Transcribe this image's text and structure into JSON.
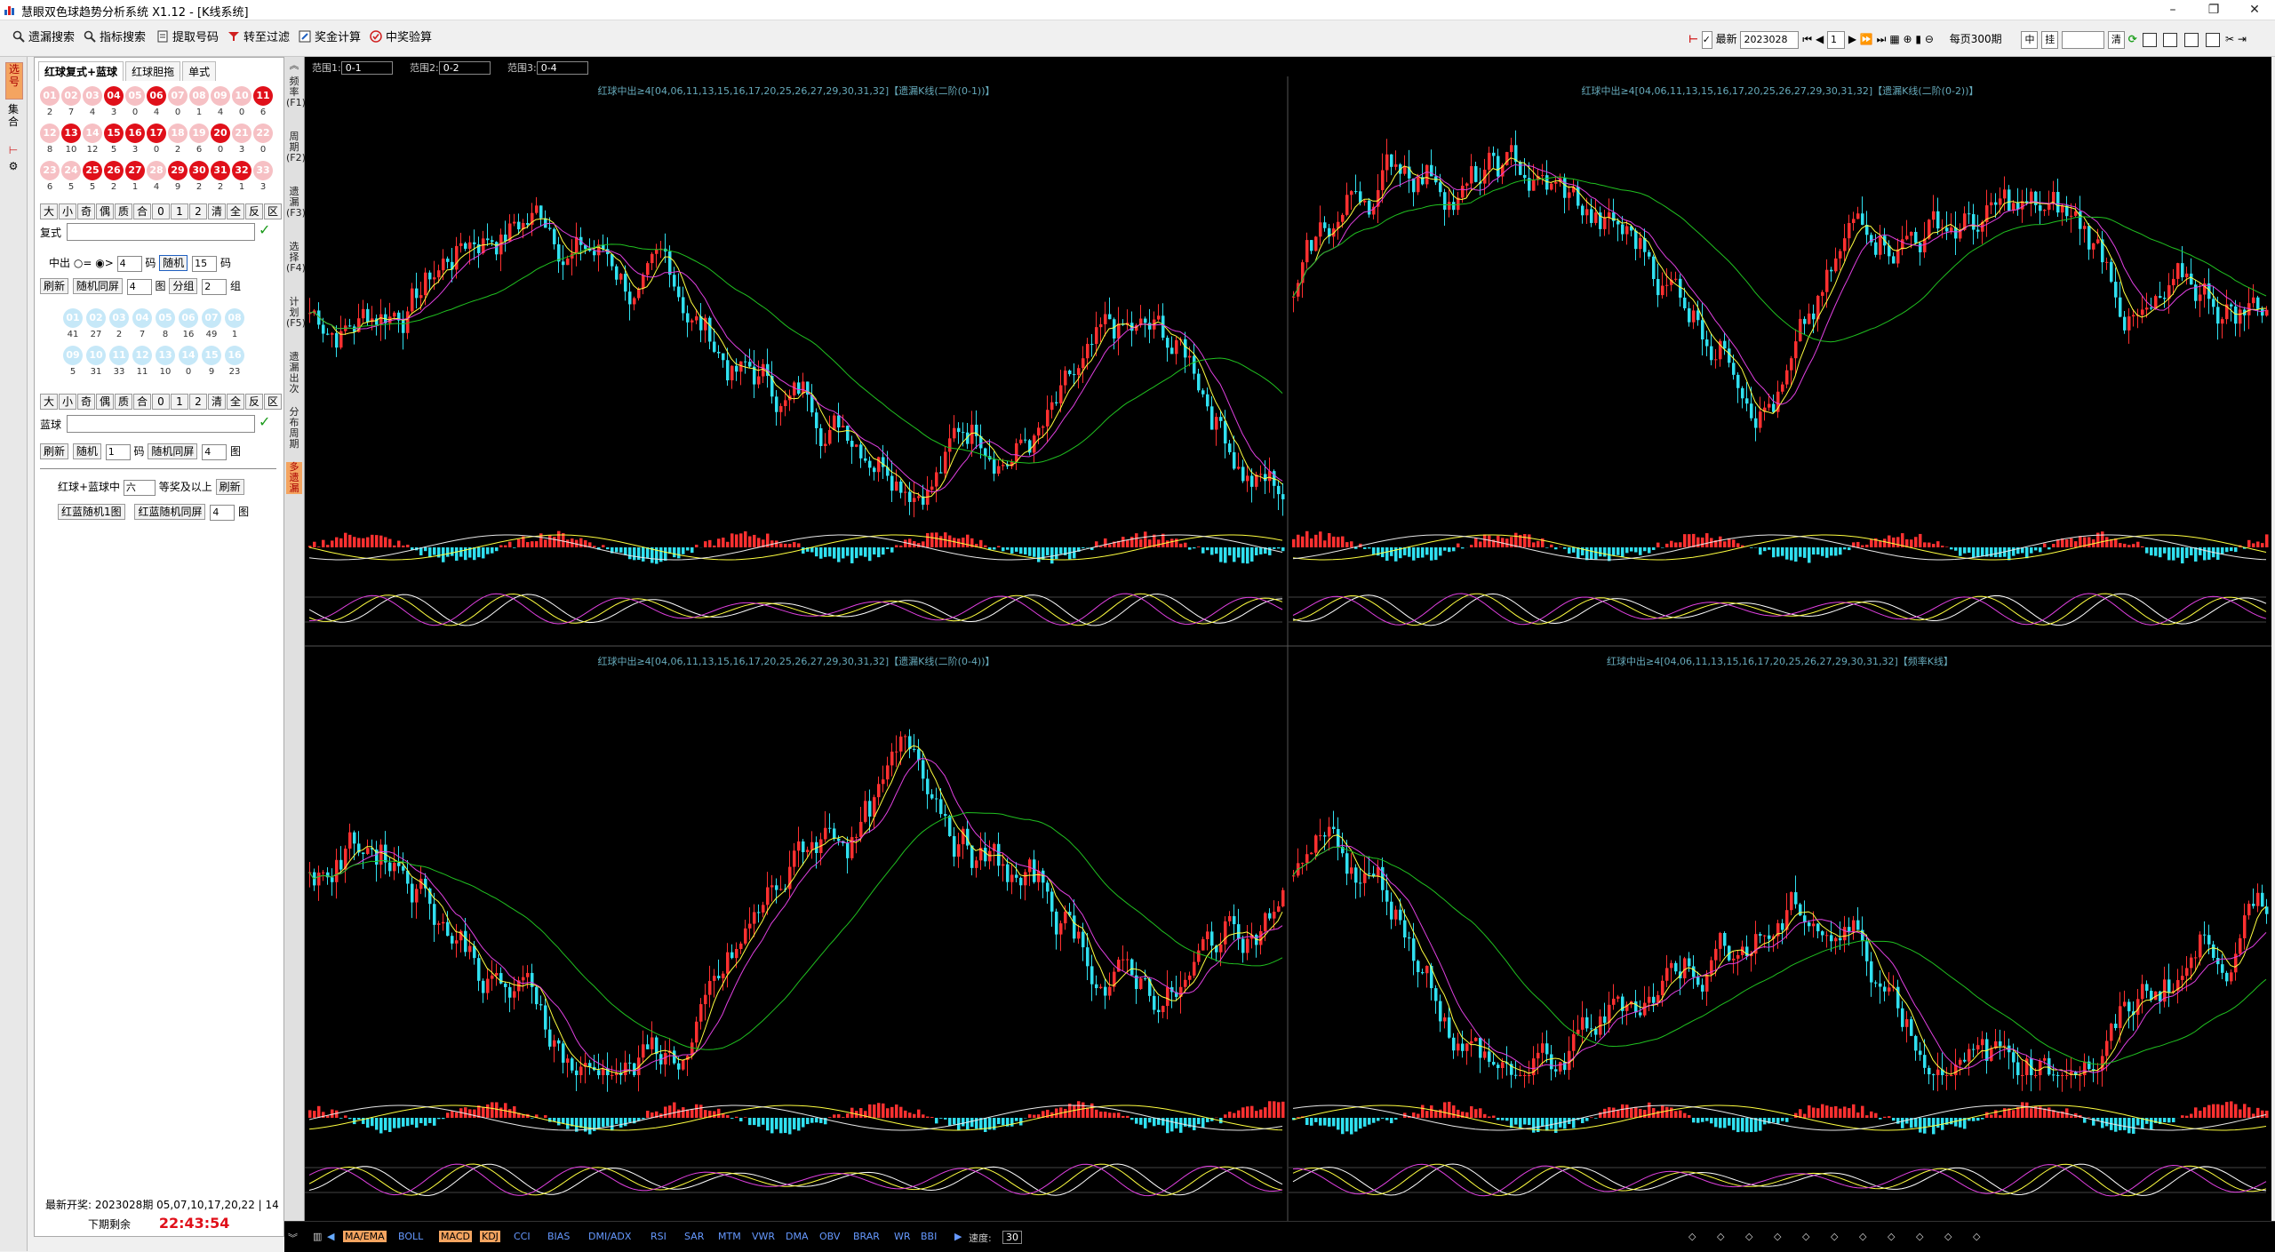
{
  "window": {
    "title": "慧眼双色球趋势分析系统 X1.12 - [K线系统]",
    "controls": [
      "–",
      "❐",
      "✕"
    ]
  },
  "toolbar": {
    "items": [
      {
        "label": "遗漏搜索",
        "icon": "search-icon"
      },
      {
        "label": "指标搜索",
        "icon": "search-icon"
      },
      {
        "label": "提取号码",
        "icon": "document-icon"
      },
      {
        "label": "转至过滤",
        "icon": "filter-icon"
      },
      {
        "label": "奖金计算",
        "icon": "edit-icon"
      },
      {
        "label": "中奖验算",
        "icon": "check-circle-icon"
      }
    ],
    "latest_label": "最新",
    "period_value": "2023028",
    "page_value": "1",
    "per_page_label": "每页300期",
    "mid_label": "中",
    "hang_label": "挂",
    "clear_label": "清"
  },
  "left_tabs": [
    {
      "label": "选号",
      "active": true
    },
    {
      "label": "集合",
      "active": false
    }
  ],
  "panel": {
    "tabs": [
      "红球复式+蓝球",
      "红球胆拖",
      "单式"
    ],
    "red_balls": [
      {
        "n": "01",
        "hit": false,
        "cnt": "2"
      },
      {
        "n": "02",
        "hit": false,
        "cnt": "7"
      },
      {
        "n": "03",
        "hit": false,
        "cnt": "4"
      },
      {
        "n": "04",
        "hit": true,
        "cnt": "3"
      },
      {
        "n": "05",
        "hit": false,
        "cnt": "0"
      },
      {
        "n": "06",
        "hit": true,
        "cnt": "4"
      },
      {
        "n": "07",
        "hit": false,
        "cnt": "0"
      },
      {
        "n": "08",
        "hit": false,
        "cnt": "1"
      },
      {
        "n": "09",
        "hit": false,
        "cnt": "4"
      },
      {
        "n": "10",
        "hit": false,
        "cnt": "0"
      },
      {
        "n": "11",
        "hit": true,
        "cnt": "6"
      },
      {
        "n": "12",
        "hit": false,
        "cnt": "8"
      },
      {
        "n": "13",
        "hit": true,
        "cnt": "10"
      },
      {
        "n": "14",
        "hit": false,
        "cnt": "12"
      },
      {
        "n": "15",
        "hit": true,
        "cnt": "5"
      },
      {
        "n": "16",
        "hit": true,
        "cnt": "3"
      },
      {
        "n": "17",
        "hit": true,
        "cnt": "0"
      },
      {
        "n": "18",
        "hit": false,
        "cnt": "2"
      },
      {
        "n": "19",
        "hit": false,
        "cnt": "6"
      },
      {
        "n": "20",
        "hit": true,
        "cnt": "0"
      },
      {
        "n": "21",
        "hit": false,
        "cnt": "3"
      },
      {
        "n": "22",
        "hit": false,
        "cnt": "0"
      },
      {
        "n": "23",
        "hit": false,
        "cnt": "6"
      },
      {
        "n": "24",
        "hit": false,
        "cnt": "5"
      },
      {
        "n": "25",
        "hit": true,
        "cnt": "5"
      },
      {
        "n": "26",
        "hit": true,
        "cnt": "2"
      },
      {
        "n": "27",
        "hit": true,
        "cnt": "1"
      },
      {
        "n": "28",
        "hit": false,
        "cnt": "4"
      },
      {
        "n": "29",
        "hit": true,
        "cnt": "9"
      },
      {
        "n": "30",
        "hit": true,
        "cnt": "2"
      },
      {
        "n": "31",
        "hit": true,
        "cnt": "2"
      },
      {
        "n": "32",
        "hit": true,
        "cnt": "1"
      },
      {
        "n": "33",
        "hit": false,
        "cnt": "3"
      }
    ],
    "filter_buttons": [
      "大",
      "小",
      "奇",
      "偶",
      "质",
      "合",
      "0",
      "1",
      "2",
      "清",
      "全",
      "反",
      "区"
    ],
    "fushi_label": "复式",
    "zhongchu_label": "中出",
    "eq_symbol": "=",
    "gt_symbol": ">",
    "zc_count": "4",
    "ma_label": "码",
    "random_btn": "随机",
    "random_count": "15",
    "refresh_btn": "刷新",
    "same_screen_btn": "随机同屏",
    "screen_count": "4",
    "tu_label": "图",
    "group_btn": "分组",
    "group_count": "2",
    "zu_label": "组",
    "blue_balls": [
      {
        "n": "01",
        "cnt": "41"
      },
      {
        "n": "02",
        "cnt": "27"
      },
      {
        "n": "03",
        "cnt": "2"
      },
      {
        "n": "04",
        "cnt": "7"
      },
      {
        "n": "05",
        "cnt": "8"
      },
      {
        "n": "06",
        "cnt": "16"
      },
      {
        "n": "07",
        "cnt": "49"
      },
      {
        "n": "08",
        "cnt": "1"
      },
      {
        "n": "09",
        "cnt": "5"
      },
      {
        "n": "10",
        "cnt": "31"
      },
      {
        "n": "11",
        "cnt": "33"
      },
      {
        "n": "12",
        "cnt": "11"
      },
      {
        "n": "13",
        "cnt": "10"
      },
      {
        "n": "14",
        "cnt": "0"
      },
      {
        "n": "15",
        "cnt": "9"
      },
      {
        "n": "16",
        "cnt": "23"
      }
    ],
    "blue_label": "蓝球",
    "blue_refresh": "刷新",
    "blue_random": "随机",
    "blue_count": "1",
    "blue_same_screen": "随机同屏",
    "blue_screen_count": "4",
    "combo_label": "红球+蓝球中",
    "combo_value": "六",
    "combo_suffix": "等奖及以上",
    "combo_refresh": "刷新",
    "red_blue_random_1": "红蓝随机1图",
    "red_blue_same": "红蓝随机同屏",
    "rb_count": "4",
    "latest_draw_label": "最新开奖:",
    "latest_draw": "2023028期 05,07,10,17,20,22 | 14",
    "next_label": "下期剩余",
    "countdown": "22:43:54"
  },
  "side_strip": [
    {
      "label": "频率(F1)",
      "active": false
    },
    {
      "label": "周期(F2)",
      "active": false
    },
    {
      "label": "遗漏(F3)",
      "active": false
    },
    {
      "label": "选择(F4)",
      "active": false
    },
    {
      "label": "计划(F5)",
      "active": false
    },
    {
      "label": "遗漏出次",
      "active": false
    },
    {
      "label": "分布周期",
      "active": false
    },
    {
      "label": "多遗漏",
      "active": true
    }
  ],
  "ranges": [
    {
      "label": "范围1:",
      "value": "0-1"
    },
    {
      "label": "范围2:",
      "value": "0-2"
    },
    {
      "label": "范围3:",
      "value": "0-4"
    }
  ],
  "charts": [
    {
      "title": "红球中出≥4[04,06,11,13,15,16,17,20,25,26,27,29,30,31,32]【遗漏K线(二阶(0-1))】"
    },
    {
      "title": "红球中出≥4[04,06,11,13,15,16,17,20,25,26,27,29,30,31,32]【遗漏K线(二阶(0-2))】"
    },
    {
      "title": "红球中出≥4[04,06,11,13,15,16,17,20,25,26,27,29,30,31,32]【遗漏K线(二阶(0-4))】"
    },
    {
      "title": "红球中出≥4[04,06,11,13,15,16,17,20,25,26,27,29,30,31,32]【频率K线】"
    }
  ],
  "indicators": [
    "MA/EMA",
    "BOLL",
    "MACD",
    "KDJ",
    "CCI",
    "BIAS",
    "DMI/ADX",
    "RSI",
    "SAR",
    "MTM",
    "VWR",
    "DMA",
    "OBV",
    "BRAR",
    "WR",
    "BBI"
  ],
  "active_indicators": [
    "MA/EMA",
    "MACD",
    "KDJ"
  ],
  "speed_label": "速度:",
  "speed_value": "30",
  "colors": {
    "red_ball": "#e0101a",
    "pink_ball": "#f6c0c4",
    "blue_ball": "#c6e8f8",
    "k_up": "#ff3030",
    "k_down": "#30e0f0",
    "ma1": "#ffff40",
    "ma2": "#e040e0",
    "ma3": "#20c020"
  }
}
